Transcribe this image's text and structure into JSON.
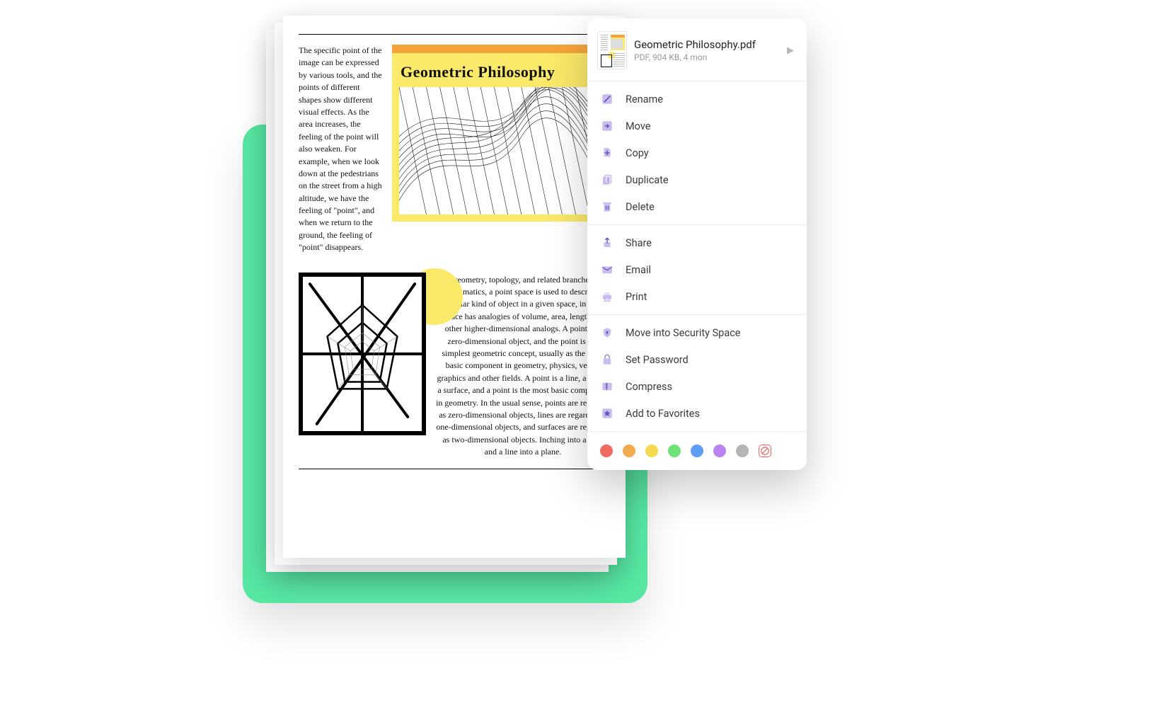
{
  "document": {
    "title": "Geometric Philosophy",
    "left_paragraph": "The specific point of the image can be expressed by various tools, and the points of different shapes show different visual effects. As the area increases, the feeling of the point will also weaken. For example, when we look down at the pedestrians on the street from a high altitude, we have the feeling of \"point\", and when we return to the ground, the feeling of \"point\" disappears.",
    "body_paragraph": "In geometry, topology, and related branches of mathematics, a point space is used to describe a particular kind of object in a given space, in which space has analogies of volume, area, length, or other higher-dimensional analogs. A point is a zero-dimensional object, and the point is the simplest geometric concept, usually as the most basic component in geometry, physics, vector graphics and other fields. A point is a line, a line is a surface, and a point is the most basic component in geometry. In the usual sense, points are regarded as zero-dimensional objects, lines are regarded as one-dimensional objects, and surfaces are regarded as two-dimensional objects. Inching into a line, and a line into a plane."
  },
  "file": {
    "name": "Geometric Philosophy.pdf",
    "meta": "PDF, 904 KB, 4 mon"
  },
  "menu": {
    "group1": [
      {
        "id": "rename",
        "label": "Rename"
      },
      {
        "id": "move",
        "label": "Move"
      },
      {
        "id": "copy",
        "label": "Copy"
      },
      {
        "id": "duplicate",
        "label": "Duplicate"
      },
      {
        "id": "delete",
        "label": "Delete"
      }
    ],
    "group2": [
      {
        "id": "share",
        "label": "Share"
      },
      {
        "id": "email",
        "label": "Email"
      },
      {
        "id": "print",
        "label": "Print"
      }
    ],
    "group3": [
      {
        "id": "security",
        "label": "Move into Security Space"
      },
      {
        "id": "password",
        "label": "Set Password"
      },
      {
        "id": "compress",
        "label": "Compress"
      },
      {
        "id": "favorite",
        "label": "Add to Favorites"
      }
    ]
  },
  "tags": [
    "red",
    "orange",
    "yellow",
    "green",
    "blue",
    "purple",
    "gray",
    "none"
  ],
  "colors": {
    "accent": "#58e6a3",
    "icon_fill": "#c9bdf0",
    "icon_stroke": "#9b86d9"
  }
}
